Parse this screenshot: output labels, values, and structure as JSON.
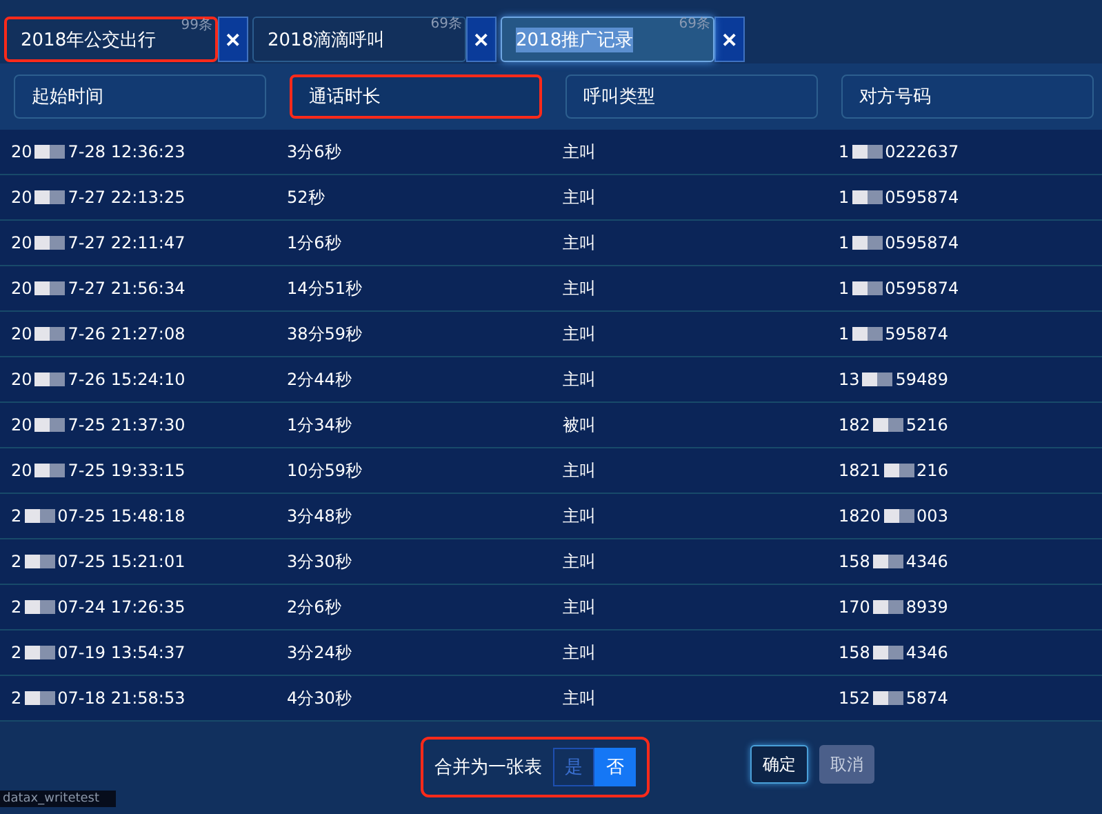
{
  "tabs": [
    {
      "label": "2018年公交出行",
      "count": "99条",
      "selected": false,
      "highlighted": true,
      "close": "✕"
    },
    {
      "label": "2018滴滴呼叫",
      "count": "69条",
      "selected": false,
      "highlighted": false,
      "close": "✕"
    },
    {
      "label": "2018推广记录",
      "count": "69条",
      "selected": true,
      "highlighted": false,
      "close": "✕"
    }
  ],
  "columns": [
    {
      "label": "起始时间",
      "highlighted": false
    },
    {
      "label": "通话时长",
      "highlighted": true
    },
    {
      "label": "呼叫类型",
      "highlighted": false
    },
    {
      "label": "对方号码",
      "highlighted": false
    }
  ],
  "rows": [
    {
      "start_time": {
        "head": "20",
        "tail": "7-28 12:36:23"
      },
      "duration": "3分6秒",
      "call_type": "主叫",
      "number": {
        "head": "1",
        "tail": "0222637"
      }
    },
    {
      "start_time": {
        "head": "20",
        "tail": "7-27 22:13:25"
      },
      "duration": "52秒",
      "call_type": "主叫",
      "number": {
        "head": "1",
        "tail": "0595874"
      }
    },
    {
      "start_time": {
        "head": "20",
        "tail": "7-27 22:11:47"
      },
      "duration": "1分6秒",
      "call_type": "主叫",
      "number": {
        "head": "1",
        "tail": "0595874"
      }
    },
    {
      "start_time": {
        "head": "20",
        "tail": "7-27 21:56:34"
      },
      "duration": "14分51秒",
      "call_type": "主叫",
      "number": {
        "head": "1",
        "tail": "0595874"
      }
    },
    {
      "start_time": {
        "head": "20",
        "tail": "7-26 21:27:08"
      },
      "duration": "38分59秒",
      "call_type": "主叫",
      "number": {
        "head": "1",
        "tail": "595874"
      }
    },
    {
      "start_time": {
        "head": "20",
        "tail": "7-26 15:24:10"
      },
      "duration": "2分44秒",
      "call_type": "主叫",
      "number": {
        "head": "13",
        "tail": "59489"
      }
    },
    {
      "start_time": {
        "head": "20",
        "tail": "7-25 21:37:30"
      },
      "duration": "1分34秒",
      "call_type": "被叫",
      "number": {
        "head": "182",
        "tail": "5216"
      }
    },
    {
      "start_time": {
        "head": "20",
        "tail": "7-25 19:33:15"
      },
      "duration": "10分59秒",
      "call_type": "主叫",
      "number": {
        "head": "1821",
        "tail": "216"
      }
    },
    {
      "start_time": {
        "head": "2",
        "tail": "07-25 15:48:18"
      },
      "duration": "3分48秒",
      "call_type": "主叫",
      "number": {
        "head": "1820",
        "tail": "003"
      }
    },
    {
      "start_time": {
        "head": "2",
        "tail": "07-25 15:21:01"
      },
      "duration": "3分30秒",
      "call_type": "主叫",
      "number": {
        "head": "158",
        "tail": "4346"
      }
    },
    {
      "start_time": {
        "head": "2",
        "tail": "07-24 17:26:35"
      },
      "duration": "2分6秒",
      "call_type": "主叫",
      "number": {
        "head": "170",
        "tail": "8939"
      }
    },
    {
      "start_time": {
        "head": "2",
        "tail": "07-19 13:54:37"
      },
      "duration": "3分24秒",
      "call_type": "主叫",
      "number": {
        "head": "158",
        "tail": "4346"
      }
    },
    {
      "start_time": {
        "head": "2",
        "tail": "07-18 21:58:53"
      },
      "duration": "4分30秒",
      "call_type": "主叫",
      "number": {
        "head": "152",
        "tail": "5874"
      }
    }
  ],
  "merge": {
    "label": "合并为一张表",
    "highlighted": true,
    "options": [
      {
        "label": "是",
        "selected": false
      },
      {
        "label": "否",
        "selected": true
      }
    ]
  },
  "buttons": [
    {
      "label": "确定",
      "kind": "primary"
    },
    {
      "label": "取消",
      "kind": "secondary"
    }
  ],
  "footer_tab": "datax_writetest"
}
